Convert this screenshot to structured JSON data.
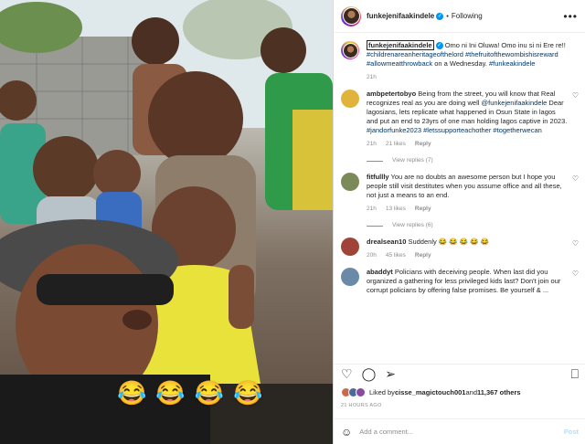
{
  "header": {
    "username": "funkejenifaakindele",
    "separator": "•",
    "follow_label": "Following",
    "more_label": "•••"
  },
  "caption": {
    "username": "funkejenifaakindele",
    "text": " Omo ni Ini Oluwa! Omo inu si ni Ere re!! ",
    "hashtags": "#childrenareanheritageofthelord #thefruitofthewombishisreward #allowmeatthrowback",
    "tail": " on a Wednesday. ",
    "hashtag2": "#funkeakindele",
    "time": "21h"
  },
  "comments": [
    {
      "username": "ambpetertobyo",
      "text_a": " Being from the street, you will know that Real recognizes real as you are doing well ",
      "mention": "@funkejenifaakindele",
      "text_b": " Dear lagosians, lets replicate what happened in Osun State in lagos and put an end to 23yrs of one man holding lagos captive in 2023. ",
      "tags": "#jandorfunke2023 #letssupporteachother #togetherwecan",
      "time": "21h",
      "likes": "21 likes",
      "reply": "Reply",
      "view_replies": "View replies (7)",
      "avatar_color": "#e0b33a"
    },
    {
      "username": "fitfullly",
      "text_a": " You are no doubts an awesome person but I hope you people still visit destitutes when you assume office and all these, not just a means to an end.",
      "time": "21h",
      "likes": "13 likes",
      "reply": "Reply",
      "view_replies": "View replies (6)",
      "avatar_color": "#7c8a5a"
    },
    {
      "username": "drealsean10",
      "text_a": " Suddenly 😂 😂 😂 😂 😂",
      "time": "20h",
      "likes": "45 likes",
      "reply": "Reply",
      "avatar_color": "#a0443a"
    },
    {
      "username": "abaddyt",
      "text_a": " Policians with deceiving people. When last did you organized a gathering for less privileged kids last? Don't join our corrupt policians by offering false promises. Be yourself & ...",
      "avatar_color": "#6a8aa8"
    }
  ],
  "actions": {
    "like_icon": "♡",
    "comment_icon": "◯",
    "share_icon": "➢",
    "bookmark_icon": "⎕"
  },
  "likes_line": {
    "prefix": "Liked by ",
    "user": "cisse_magictouch001",
    "middle": " and ",
    "count": "11,367 others"
  },
  "post_time": "21 HOURS AGO",
  "add_comment": {
    "icon": "☺",
    "placeholder": "Add a comment...",
    "post_label": "Post"
  },
  "photo": {
    "emojis": [
      "😂",
      "😂",
      "😂",
      "😂"
    ]
  }
}
